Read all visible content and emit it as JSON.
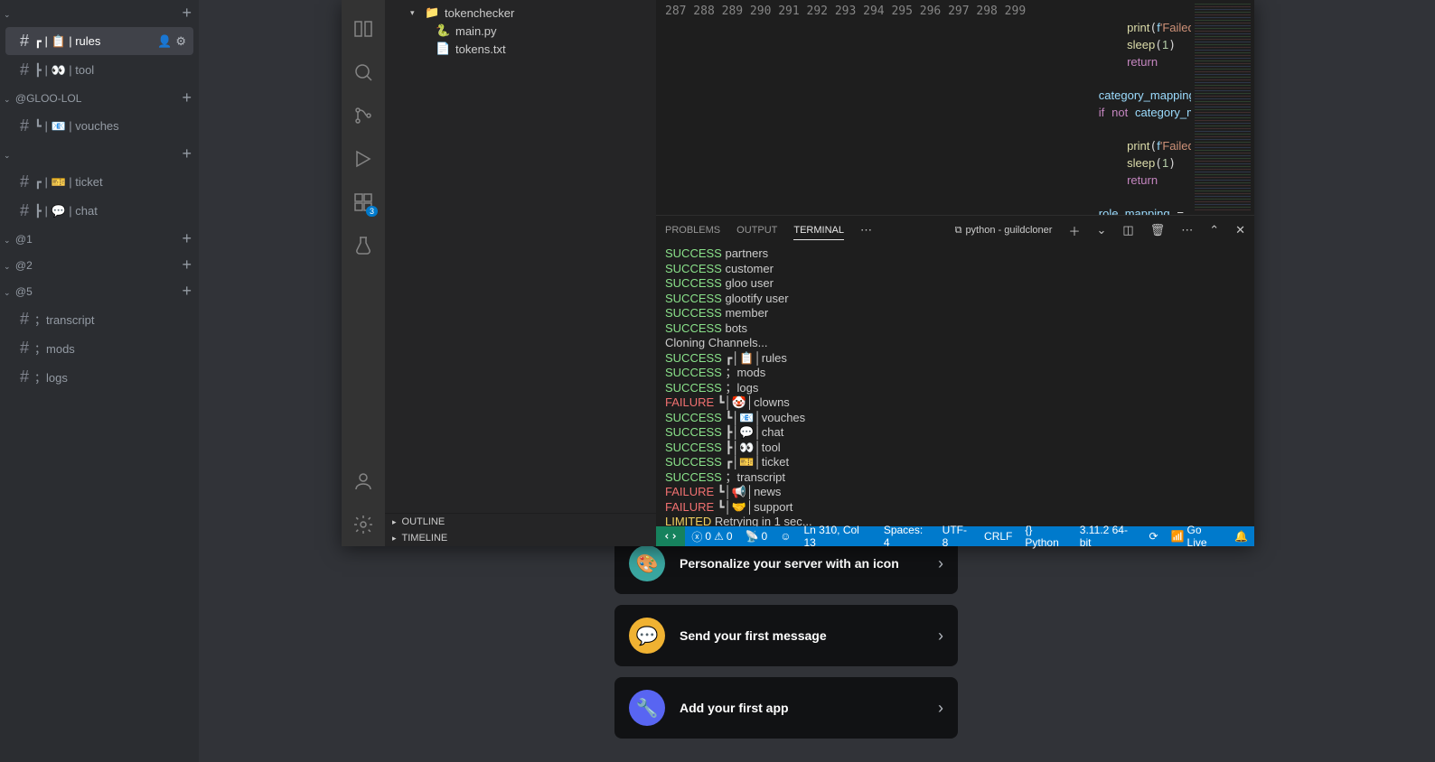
{
  "discord": {
    "categories": [
      {
        "name": "</>",
        "id": "code",
        "channels": [
          {
            "label": "┏ | 📋 | rules",
            "selected": true,
            "showCtl": true,
            "id": "rules"
          },
          {
            "label": "┣ | 👀 | tool",
            "id": "tool"
          }
        ]
      },
      {
        "name": "@GLOO-LOL",
        "id": "gloo",
        "channels": [
          {
            "label": "┗ | 📧 | vouches",
            "id": "vouches"
          }
        ]
      },
      {
        "name": "</>",
        "id": "ticketcat",
        "channels": [
          {
            "label": "┏ | 🎫 | ticket",
            "id": "ticket"
          },
          {
            "label": "┣ | 💬 | chat",
            "id": "chat"
          }
        ]
      },
      {
        "name": "@1",
        "id": "c1",
        "channels": []
      },
      {
        "name": "@2",
        "id": "c2",
        "channels": []
      },
      {
        "name": "@5",
        "id": "c5",
        "channels": [
          {
            "label": "；transcript",
            "id": "transcript"
          },
          {
            "label": "；mods",
            "id": "mods"
          },
          {
            "label": "；logs",
            "id": "logs"
          }
        ]
      }
    ],
    "cards": [
      {
        "icon": "🎨",
        "bg": "#3aa6a0",
        "label": "Personalize your server with an icon",
        "id": "personalize"
      },
      {
        "icon": "💬",
        "bg": "#f0b232",
        "label": "Send your first message",
        "id": "first-message"
      },
      {
        "icon": "🔧",
        "bg": "#5865f2",
        "label": "Add your first app",
        "id": "first-app"
      }
    ]
  },
  "vscode": {
    "explorer": {
      "folder": "tokenchecker",
      "files": [
        {
          "name": "main.py",
          "icon": "🐍",
          "id": "main-py"
        },
        {
          "name": "tokens.txt",
          "icon": "📄",
          "id": "tokens-txt"
        }
      ],
      "outline": "OUTLINE",
      "timeline": "TIMELINE"
    },
    "editor": {
      "lines": [
        {
          "n": 287,
          "html": ""
        },
        {
          "n": 288,
          "html": "            <span class='tok-fn'>print</span>(<span class='tok-id'>f</span><span class='tok-str'>'Failed to fetch categories and channels from sourc</span>"
        },
        {
          "n": 289,
          "html": "            <span class='tok-fn'>sleep</span>(<span class='tok-num'>1</span>)"
        },
        {
          "n": 290,
          "html": "            <span class='tok-kw'>return</span>"
        },
        {
          "n": 291,
          "html": ""
        },
        {
          "n": 292,
          "html": "        <span class='tok-id'>category_mapping</span> <span class='tok-op'>=</span> <span class='tok-fn'>clone_categories</span>(<span class='tok-id'>token</span>, <span class='tok-id'>copyserver</span>, <span class='tok-id'>yourser</span>"
        },
        {
          "n": 293,
          "html": "        <span class='tok-kw'>if</span> <span class='tok-kw'>not</span> <span class='tok-id'>category_mapping</span>:"
        },
        {
          "n": 294,
          "html": ""
        },
        {
          "n": 295,
          "html": "            <span class='tok-fn'>print</span>(<span class='tok-id'>f</span><span class='tok-str'>'Failed to clone categories.'</span>)"
        },
        {
          "n": 296,
          "html": "            <span class='tok-fn'>sleep</span>(<span class='tok-num'>1</span>)"
        },
        {
          "n": 297,
          "html": "            <span class='tok-kw'>return</span>"
        },
        {
          "n": 298,
          "html": ""
        },
        {
          "n": 299,
          "html": "        <span class='tok-id'>role_mapping</span> <span class='tok-op'>=</span> <span class='tok-fn'>clone_roles</span>(<span class='tok-id'>token</span>, <span class='tok-id'>copyserver</span>, <span class='tok-id'>yourserver</span>)"
        }
      ]
    },
    "panel": {
      "tabs": {
        "problems": "PROBLEMS",
        "output": "OUTPUT",
        "terminal": "TERMINAL"
      },
      "termProcess": "python - guildcloner",
      "terminalLines": [
        {
          "cls": "t-s",
          "text": "SUCCESS partners"
        },
        {
          "cls": "t-s",
          "text": "SUCCESS customer"
        },
        {
          "cls": "t-s",
          "text": "SUCCESS gloo user"
        },
        {
          "cls": "t-s",
          "text": "SUCCESS glootify user"
        },
        {
          "cls": "t-s",
          "text": "SUCCESS member"
        },
        {
          "cls": "t-s",
          "text": "SUCCESS bots"
        },
        {
          "cls": "",
          "text": "Cloning Channels..."
        },
        {
          "cls": "t-s",
          "text": "SUCCESS ┏│📋│rules"
        },
        {
          "cls": "t-s",
          "text": "SUCCESS ；mods"
        },
        {
          "cls": "t-s",
          "text": "SUCCESS ；logs"
        },
        {
          "cls": "t-f",
          "text": "FAILURE ┗│🤡│clowns"
        },
        {
          "cls": "t-s",
          "text": "SUCCESS ┗│📧│vouches"
        },
        {
          "cls": "t-s",
          "text": "SUCCESS ┣│💬│chat"
        },
        {
          "cls": "t-s",
          "text": "SUCCESS ┣│👀│tool"
        },
        {
          "cls": "t-s",
          "text": "SUCCESS ┏│🎫│ticket"
        },
        {
          "cls": "t-s",
          "text": "SUCCESS ；transcript"
        },
        {
          "cls": "t-f",
          "text": "FAILURE ┗│📢│news"
        },
        {
          "cls": "t-f",
          "text": "FAILURE ┗│🤝│support"
        },
        {
          "cls": "t-l",
          "text": "LIMITED Retrying in 1 sec..."
        },
        {
          "cls": "",
          "text": "▮"
        }
      ]
    },
    "status": {
      "errors": "0",
      "warnings": "0",
      "ports": "0",
      "cursor": "Ln 310, Col 13",
      "spaces": "Spaces: 4",
      "encoding": "UTF-8",
      "eol": "CRLF",
      "lang": "{} Python",
      "interp": "3.11.2 64-bit",
      "golive": "Go Live"
    }
  }
}
